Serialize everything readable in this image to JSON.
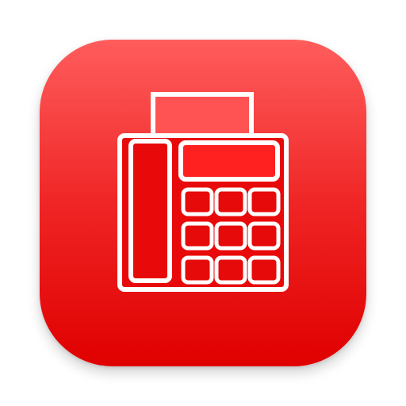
{
  "app_icon": {
    "name": "fax-machine",
    "colors": {
      "gradient_top": "#ff4a4a",
      "gradient_bottom": "#e00000",
      "glyph_outline": "#ffffff",
      "paper_fill": "#ff5252",
      "key_fill": "#e60a0a"
    },
    "keypad": {
      "rows": 3,
      "columns": 3
    }
  }
}
